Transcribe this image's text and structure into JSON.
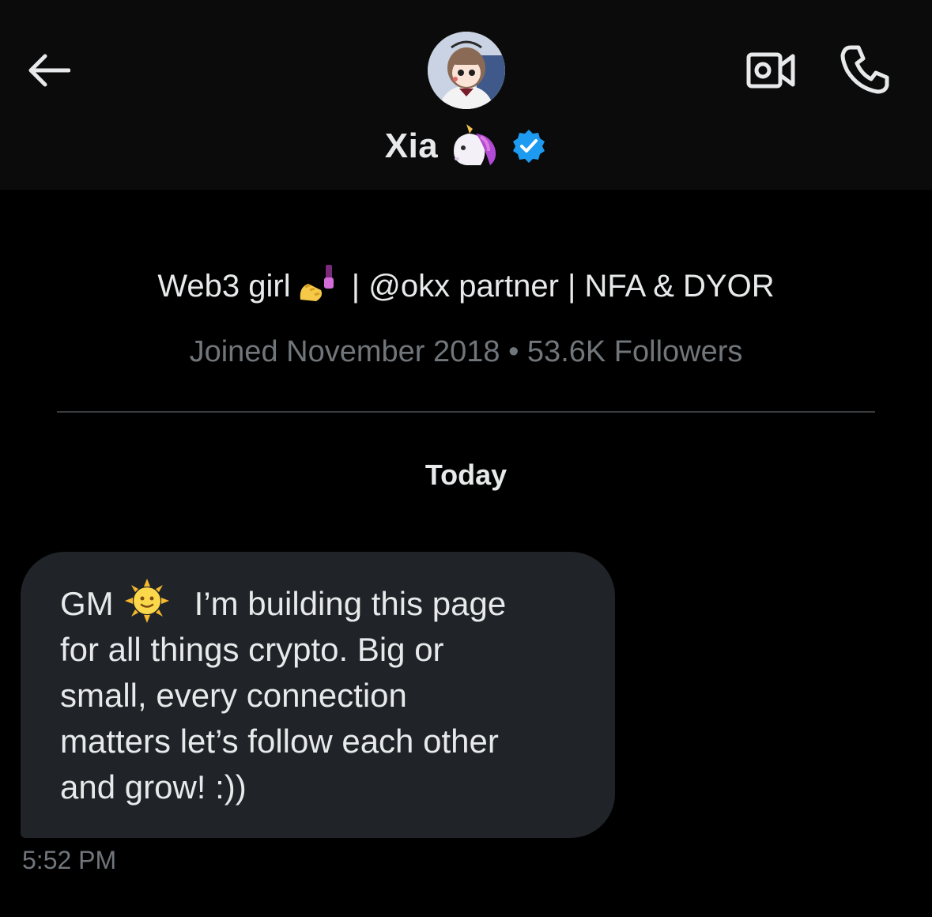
{
  "header": {
    "name": "Xia",
    "icons": {
      "back": "back-arrow-icon",
      "video": "video-call-icon",
      "call": "phone-icon",
      "verified": "verified-badge-icon",
      "name_emoji": "unicorn-emoji"
    },
    "accent_color": "#1d9bf0"
  },
  "profile": {
    "bio_part1": "Web3 girl",
    "bio_emoji": "nail-polish-emoji",
    "bio_part2": " | @okx partner | NFA & DYOR",
    "meta": "Joined November 2018 • 53.6K Followers"
  },
  "conversation": {
    "date_separator": "Today",
    "message": {
      "line1_a": "GM",
      "line1_emoji": "sun-with-face-emoji",
      "line1_b": "I’m building this page",
      "line2": "for all things crypto. Big or",
      "line3": "small,  every connection",
      "line4": "matters let’s follow each other",
      "line5": "and grow! :))",
      "time": "5:52 PM"
    }
  },
  "colors": {
    "background": "#000000",
    "header_bg": "#0b0b0b",
    "bubble_bg": "#202327",
    "secondary_text": "#71767b"
  }
}
